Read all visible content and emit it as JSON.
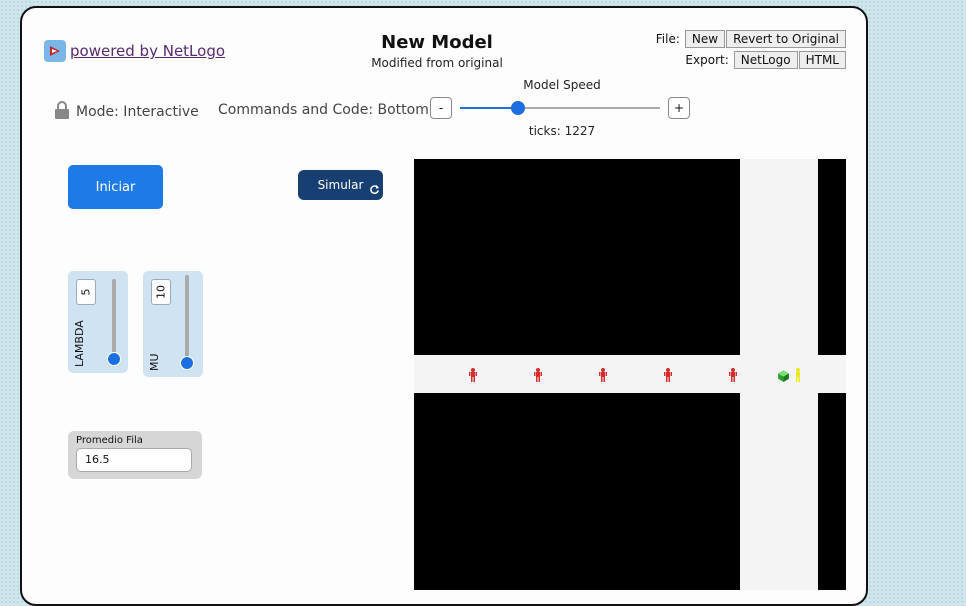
{
  "header": {
    "brand_label": "powered by NetLogo",
    "model_title": "New Model",
    "model_subtitle": "Modified from original"
  },
  "file_menu": {
    "file_label": "File:",
    "new_label": "New",
    "revert_label": "Revert to Original",
    "export_label": "Export:",
    "netlogo_label": "NetLogo",
    "html_label": "HTML"
  },
  "toolbar": {
    "mode_label": "Mode: Interactive",
    "commands_label": "Commands and Code: Bottom",
    "speed_label": "Model Speed",
    "speed_minus": "-",
    "speed_plus": "+",
    "speed_value": 0.29,
    "ticks_label": "ticks: 1227"
  },
  "buttons": {
    "iniciar_label": "Iniciar",
    "simular_label": "Simular"
  },
  "sliders": [
    {
      "name": "LAMBDA",
      "value": "5",
      "level": 0.0
    },
    {
      "name": "MU",
      "value": "10",
      "level": 0.0
    }
  ],
  "monitor": {
    "label": "Promedio Fila",
    "value": "16.5"
  },
  "world": {
    "background_color": "#000000",
    "road_color": "#f4f4f4",
    "person_color": "#d42b2b",
    "server_color": "#3cc43c",
    "served_person_color": "#e8e820",
    "queue_count": 5
  },
  "colors": {
    "accent": "#1e7ae6",
    "dark_button": "#173f72",
    "slider_bg": "#cfe3f2"
  }
}
